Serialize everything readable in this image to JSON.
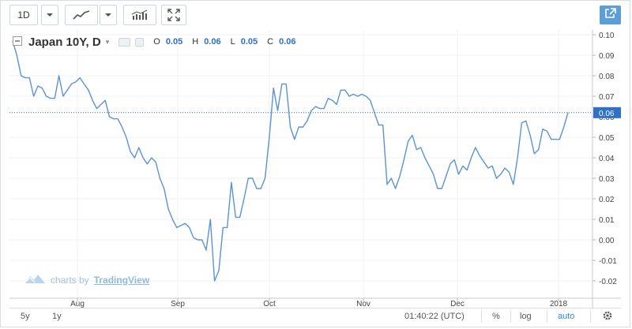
{
  "toolbar": {
    "interval_label": "1D",
    "chart_style_icon": "line-chart-icon",
    "indicators_icon": "indicators-icon",
    "fullscreen_icon": "fullscreen-icon",
    "share_icon": "share-icon"
  },
  "legend": {
    "symbol": "Japan 10Y, D",
    "open_key": "O",
    "open_value": "0.05",
    "high_key": "H",
    "high_value": "0.06",
    "low_key": "L",
    "low_value": "0.05",
    "close_key": "C",
    "close_value": "0.06"
  },
  "watermark": {
    "prefix": "charts by",
    "brand": "TradingView"
  },
  "bottom": {
    "range_5y": "5y",
    "range_1y": "1y",
    "clock": "01:40:22 (UTC)",
    "percent": "%",
    "log": "log",
    "auto": "auto",
    "settings_icon": "gear-icon"
  },
  "colors": {
    "line": "#5b92d6",
    "last_price_bg": "#2f70c8",
    "accent_auto": "#2f8ae0"
  },
  "chart_data": {
    "type": "line",
    "title": "Japan 10Y, D",
    "xlabel": "",
    "ylabel": "",
    "x_tick_labels": [
      "Aug",
      "Sep",
      "Oct",
      "Nov",
      "Dec",
      "2018"
    ],
    "y_tick_labels": [
      "0.10",
      "0.09",
      "0.08",
      "0.07",
      "0.06",
      "0.05",
      "0.04",
      "0.03",
      "0.02",
      "0.01",
      "0.00",
      "-0.01",
      "-0.02"
    ],
    "ylim": [
      -0.025,
      0.1
    ],
    "last_value_label": "0.06",
    "last_value": 0.062,
    "grid": true,
    "series": [
      {
        "values": [
          0.097,
          0.09,
          0.08,
          0.079,
          0.079,
          0.07,
          0.075,
          0.074,
          0.07,
          0.069,
          0.069,
          0.08,
          0.07,
          0.073,
          0.076,
          0.077,
          0.079,
          0.076,
          0.073,
          0.068,
          0.064,
          0.066,
          0.068,
          0.06,
          0.059,
          0.059,
          0.055,
          0.05,
          0.043,
          0.04,
          0.045,
          0.04,
          0.037,
          0.04,
          0.038,
          0.03,
          0.025,
          0.015,
          0.01,
          0.006,
          0.007,
          0.008,
          0.006,
          0.001,
          0.0,
          0.0,
          -0.005,
          0.01,
          -0.02,
          -0.015,
          0.006,
          0.006,
          0.028,
          0.011,
          0.011,
          0.02,
          0.03,
          0.03,
          0.025,
          0.025,
          0.03,
          0.05,
          0.074,
          0.063,
          0.076,
          0.076,
          0.055,
          0.049,
          0.055,
          0.055,
          0.058,
          0.063,
          0.065,
          0.064,
          0.064,
          0.069,
          0.068,
          0.066,
          0.073,
          0.073,
          0.07,
          0.071,
          0.07,
          0.071,
          0.07,
          0.068,
          0.062,
          0.056,
          0.056,
          0.027,
          0.03,
          0.025,
          0.031,
          0.039,
          0.048,
          0.051,
          0.044,
          0.045,
          0.04,
          0.036,
          0.032,
          0.025,
          0.025,
          0.031,
          0.037,
          0.039,
          0.032,
          0.036,
          0.034,
          0.04,
          0.045,
          0.041,
          0.038,
          0.035,
          0.036,
          0.03,
          0.032,
          0.035,
          0.033,
          0.027,
          0.04,
          0.057,
          0.058,
          0.051,
          0.042,
          0.044,
          0.054,
          0.053,
          0.049,
          0.049,
          0.049,
          0.055,
          0.062
        ]
      }
    ]
  }
}
